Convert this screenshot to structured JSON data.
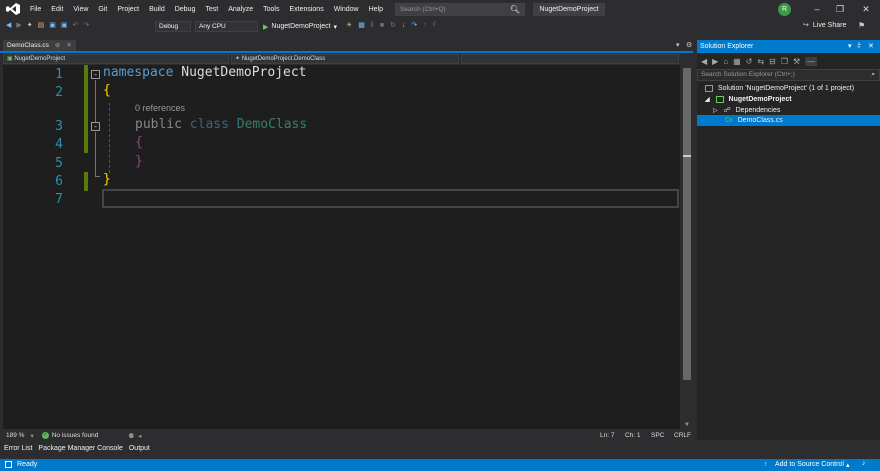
{
  "menubar": {
    "items": [
      "File",
      "Edit",
      "View",
      "Git",
      "Project",
      "Build",
      "Debug",
      "Test",
      "Analyze",
      "Tools",
      "Extensions",
      "Window",
      "Help"
    ],
    "search_placeholder": "Search (Ctrl+Q)",
    "solution_title": "NugetDemoProject",
    "avatar_initial": "R"
  },
  "toolbar": {
    "config": "Debug",
    "platform": "Any CPU",
    "run_target": "NugetDemoProject",
    "live_share": "Live Share"
  },
  "tabs": {
    "active_file": "DemoClass.cs"
  },
  "navbar": {
    "project": "NugetDemoProject",
    "type": "NugetDemoProject.DemoClass"
  },
  "editor": {
    "line_numbers": [
      "1",
      "2",
      "3",
      "4",
      "5",
      "6",
      "7"
    ],
    "codelens": "0 references",
    "code": {
      "l1_keyword": "namespace",
      "l1_name": "NugetDemoProject",
      "l2_brace": "{",
      "l3_mod": "public",
      "l3_kw": "class",
      "l3_name": "DemoClass",
      "l4_brace": "{",
      "l5_brace": "}",
      "l6_brace": "}"
    }
  },
  "editor_status": {
    "zoom": "189 %",
    "issues": "No issues found",
    "line": "Ln: 7",
    "col": "Ch: 1",
    "spc": "SPC",
    "eol": "CRLF"
  },
  "bottom_tabs": [
    "Error List",
    "Package Manager Console",
    "Output"
  ],
  "statusbar": {
    "ready": "Ready",
    "source_control": "Add to Source Control"
  },
  "solution_explorer": {
    "title": "Solution Explorer",
    "search_placeholder": "Search Solution Explorer (Ctrl+;)",
    "solution": "Solution 'NugetDemoProject' (1 of 1 project)",
    "project": "NugetDemoProject",
    "dependencies": "Dependencies",
    "file": "DemoClass.cs"
  },
  "colors": {
    "accent": "#007acc",
    "editor_bg": "#1e1e1e",
    "keyword": "#569cd6",
    "type": "#4ec9b0",
    "line_number": "#2b91af",
    "brace_level1": "#ffd700",
    "brace_level2": "#da70d6"
  }
}
